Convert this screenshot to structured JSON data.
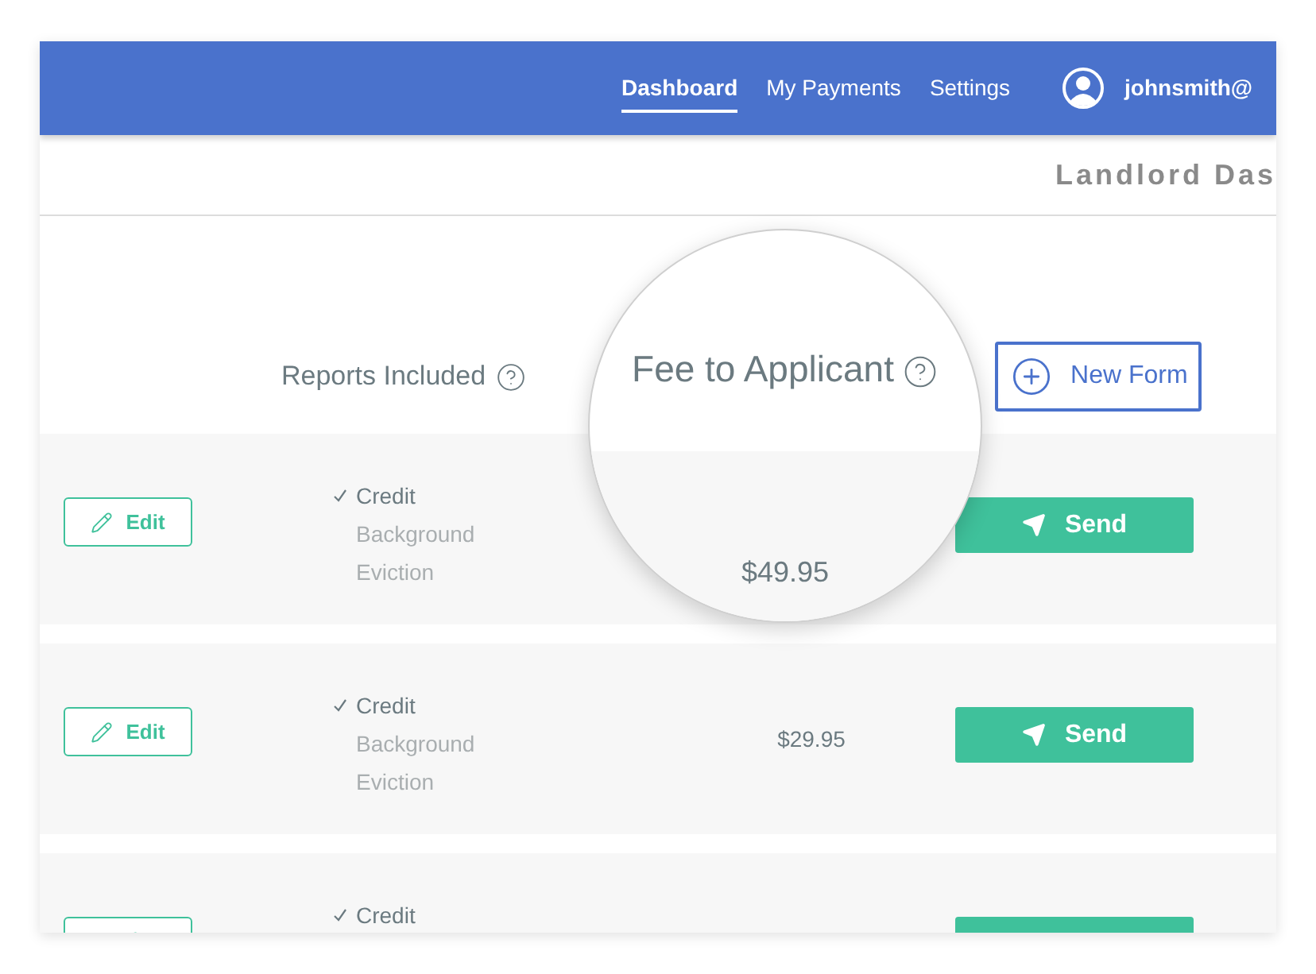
{
  "nav": {
    "items": [
      {
        "label": "Dashboard",
        "selected": true
      },
      {
        "label": "My Payments",
        "selected": false
      },
      {
        "label": "Settings",
        "selected": false
      }
    ],
    "user": "johnsmith@"
  },
  "subheader": {
    "title": "Landlord Das"
  },
  "table": {
    "columns": [
      {
        "label": "Reports Included"
      }
    ],
    "new_form": "New Form",
    "rows": [
      {
        "edit": "Edit",
        "reports": [
          {
            "label": "Credit",
            "included": true
          },
          {
            "label": "Background",
            "included": false
          },
          {
            "label": "Eviction",
            "included": false
          }
        ],
        "send": "Send"
      },
      {
        "edit": "Edit",
        "reports": [
          {
            "label": "Credit",
            "included": true
          },
          {
            "label": "Background",
            "included": false
          },
          {
            "label": "Eviction",
            "included": false
          }
        ],
        "fee": "$29.95",
        "send": "Send"
      },
      {
        "reports": [
          {
            "label": "Credit",
            "included": true
          }
        ]
      }
    ]
  },
  "magnifier": {
    "header": "Fee to Applicant",
    "value": "$49.95"
  }
}
